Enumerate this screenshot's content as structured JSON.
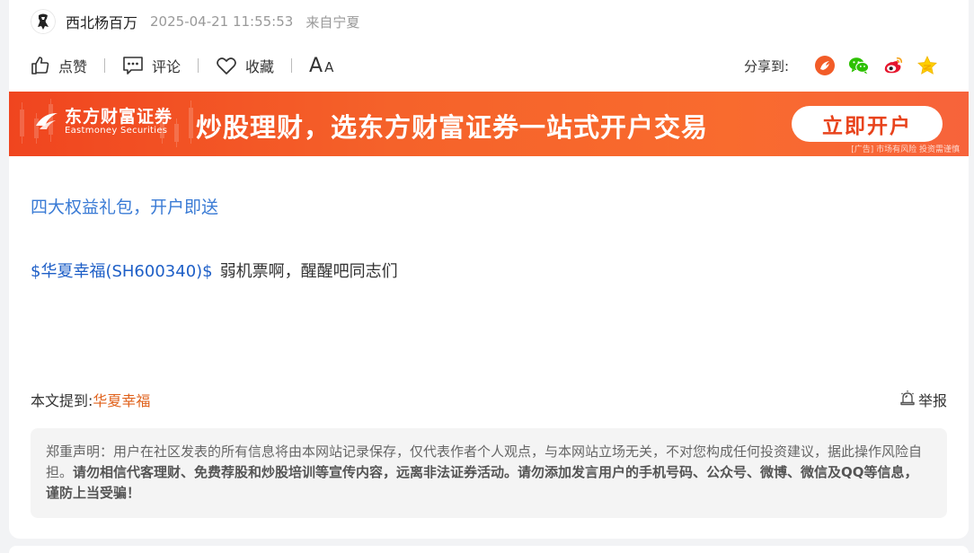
{
  "author": {
    "name": "西北杨百万",
    "time": "2025-04-21 11:55:53",
    "from": "来自宁夏"
  },
  "actions": {
    "like": "点赞",
    "comment": "评论",
    "favorite": "收藏",
    "font_big": "A",
    "font_small": "A"
  },
  "share": {
    "label": "分享到:",
    "icons": [
      "xueqiu-share-icon",
      "wechat-icon",
      "weibo-icon",
      "qzone-star-icon"
    ]
  },
  "banner": {
    "logo_cn": "东方财富证券",
    "logo_en": "Eastmoney Securities",
    "headline": "炒股理财，选东方财富证券一站式开户交易",
    "button": "立即开户",
    "ad_note": "[广告] 市场有风险 投资需谨慎"
  },
  "promo_link": "四大权益礼包，开户即送",
  "post": {
    "stock": "$华夏幸福(SH600340)$",
    "text": "弱机票啊，醒醒吧同志们"
  },
  "mentions": {
    "label": "本文提到:",
    "stock": "华夏幸福"
  },
  "report": "举报",
  "disclaimer": {
    "normal": "郑重声明：用户在社区发表的所有信息将由本网站记录保存，仅代表作者个人观点，与本网站立场无关，不对您构成任何投资建议，据此操作风险自担。",
    "bold": "请勿相信代客理财、免费荐股和炒股培训等宣传内容，远离非法证券活动。请勿添加发言用户的手机号码、公众号、微博、微信及QQ等信息，谨防上当受骗！"
  },
  "colors": {
    "link_blue": "#3a7bd5",
    "stock_blue": "#1e5fc7",
    "mention_orange": "#e0621c",
    "banner_orange": "#f5622a"
  }
}
